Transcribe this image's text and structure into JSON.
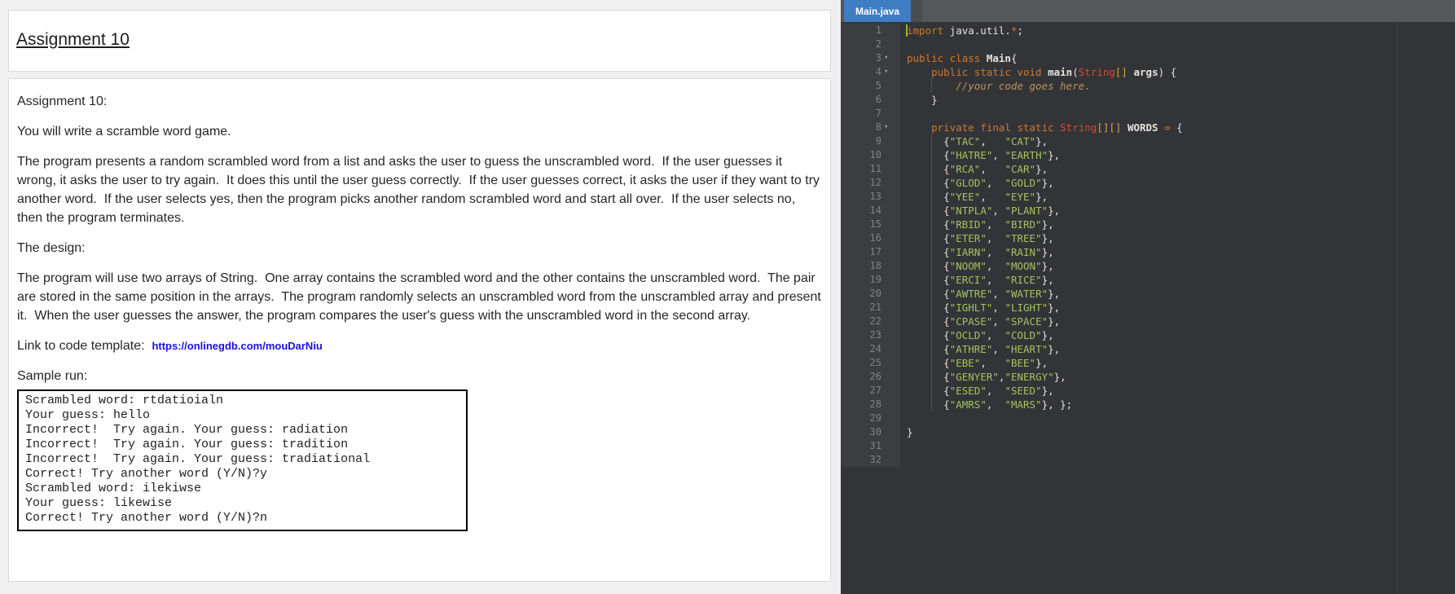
{
  "document": {
    "title": "Assignment 10",
    "heading_label": "Assignment 10:",
    "intro": "You will write a scramble word game.",
    "para1": "The program presents a random scrambled word from a list and asks the user to guess the unscrambled word.  If the user guesses it wrong, it asks the user to try again.  It does this until the user guess correctly.  If the user guesses correct, it asks the user if they want to try another word.  If the user selects yes, then the program picks another random scrambled word and start all over.  If the user selects no, then the program terminates.",
    "design_label": "The design:",
    "para2": "The program will use two arrays of String.  One array contains the scrambled word and the other contains the unscrambled word.  The pair are stored in the same position in the arrays.  The program randomly selects an unscrambled word from the unscrambled array and present it.  When the user guesses the answer, the program compares the user's guess with the unscrambled word in the second array.",
    "link_label": "Link to code template:",
    "link_url": "https://onlinegdb.com/mouDarNiu",
    "link_color": "#1a10e0",
    "sample_label": "Sample run:",
    "sample_lines": [
      "Scrambled word: rtdatioialn",
      "Your guess: hello",
      "Incorrect!  Try again. Your guess: radiation",
      "Incorrect!  Try again. Your guess: tradition",
      "Incorrect!  Try again. Your guess: tradiational",
      "Correct! Try another word (Y/N)?y",
      "Scrambled word: ilekiwse",
      "Your guess: likewise",
      "Correct! Try another word (Y/N)?n"
    ]
  },
  "editor": {
    "tab_title": "Main.java",
    "tab_color": "#3e7dc1",
    "background": "#333437",
    "gutter_background": "#3c3d40",
    "cursor_color": "#7fc41e",
    "fold_glyph": "▾",
    "palette": {
      "k": "#cc7833",
      "t": "#e6e1dc",
      "y": "#da4939",
      "b": "#d9a04a",
      "s": "#a5c261",
      "c": "#bc9458",
      "f": "#e6e1dc"
    },
    "lines": [
      {
        "n": 1,
        "cursor": true,
        "tokens": [
          [
            "k",
            "import"
          ],
          [
            "t",
            " java.util."
          ],
          [
            "k",
            "*"
          ],
          [
            "t",
            ";"
          ]
        ]
      },
      {
        "n": 2,
        "tokens": []
      },
      {
        "n": 3,
        "fold": true,
        "tokens": [
          [
            "k",
            "public class"
          ],
          [
            "f",
            " Main"
          ],
          [
            "t",
            "{"
          ]
        ]
      },
      {
        "n": 4,
        "fold": true,
        "tokens": [
          [
            "t",
            "    "
          ],
          [
            "k",
            "public static void"
          ],
          [
            "f",
            " main"
          ],
          [
            "t",
            "("
          ],
          [
            "y",
            "String"
          ],
          [
            "b",
            "[]"
          ],
          [
            "f",
            " args"
          ],
          [
            "t",
            ") {"
          ]
        ]
      },
      {
        "n": 5,
        "guide": true,
        "tokens": [
          [
            "c",
            "        //your code goes here."
          ]
        ]
      },
      {
        "n": 6,
        "tokens": [
          [
            "t",
            "    }"
          ]
        ]
      },
      {
        "n": 7,
        "tokens": []
      },
      {
        "n": 8,
        "fold": true,
        "tokens": [
          [
            "t",
            "    "
          ],
          [
            "k",
            "private final static"
          ],
          [
            "t",
            " "
          ],
          [
            "y",
            "String"
          ],
          [
            "b",
            "[][]"
          ],
          [
            "f",
            " WORDS"
          ],
          [
            "t",
            " "
          ],
          [
            "k",
            "="
          ],
          [
            "t",
            " {"
          ]
        ]
      },
      {
        "n": 9,
        "guide": true,
        "tokens": [
          [
            "t",
            "      {"
          ],
          [
            "s",
            "\"TAC\""
          ],
          [
            "t",
            ",   "
          ],
          [
            "s",
            "\"CAT\""
          ],
          [
            "t",
            "},"
          ]
        ]
      },
      {
        "n": 10,
        "guide": true,
        "tokens": [
          [
            "t",
            "      {"
          ],
          [
            "s",
            "\"HATRE\""
          ],
          [
            "t",
            ", "
          ],
          [
            "s",
            "\"EARTH\""
          ],
          [
            "t",
            "},"
          ]
        ]
      },
      {
        "n": 11,
        "guide": true,
        "tokens": [
          [
            "t",
            "      {"
          ],
          [
            "s",
            "\"RCA\""
          ],
          [
            "t",
            ",   "
          ],
          [
            "s",
            "\"CAR\""
          ],
          [
            "t",
            "},"
          ]
        ]
      },
      {
        "n": 12,
        "guide": true,
        "tokens": [
          [
            "t",
            "      {"
          ],
          [
            "s",
            "\"GLOD\""
          ],
          [
            "t",
            ",  "
          ],
          [
            "s",
            "\"GOLD\""
          ],
          [
            "t",
            "},"
          ]
        ]
      },
      {
        "n": 13,
        "guide": true,
        "tokens": [
          [
            "t",
            "      {"
          ],
          [
            "s",
            "\"YEE\""
          ],
          [
            "t",
            ",   "
          ],
          [
            "s",
            "\"EYE\""
          ],
          [
            "t",
            "},"
          ]
        ]
      },
      {
        "n": 14,
        "guide": true,
        "tokens": [
          [
            "t",
            "      {"
          ],
          [
            "s",
            "\"NTPLA\""
          ],
          [
            "t",
            ", "
          ],
          [
            "s",
            "\"PLANT\""
          ],
          [
            "t",
            "},"
          ]
        ]
      },
      {
        "n": 15,
        "guide": true,
        "tokens": [
          [
            "t",
            "      {"
          ],
          [
            "s",
            "\"RBID\""
          ],
          [
            "t",
            ",  "
          ],
          [
            "s",
            "\"BIRD\""
          ],
          [
            "t",
            "},"
          ]
        ]
      },
      {
        "n": 16,
        "guide": true,
        "tokens": [
          [
            "t",
            "      {"
          ],
          [
            "s",
            "\"ETER\""
          ],
          [
            "t",
            ",  "
          ],
          [
            "s",
            "\"TREE\""
          ],
          [
            "t",
            "},"
          ]
        ]
      },
      {
        "n": 17,
        "guide": true,
        "tokens": [
          [
            "t",
            "      {"
          ],
          [
            "s",
            "\"IARN\""
          ],
          [
            "t",
            ",  "
          ],
          [
            "s",
            "\"RAIN\""
          ],
          [
            "t",
            "},"
          ]
        ]
      },
      {
        "n": 18,
        "guide": true,
        "tokens": [
          [
            "t",
            "      {"
          ],
          [
            "s",
            "\"NOOM\""
          ],
          [
            "t",
            ",  "
          ],
          [
            "s",
            "\"MOON\""
          ],
          [
            "t",
            "},"
          ]
        ]
      },
      {
        "n": 19,
        "guide": true,
        "tokens": [
          [
            "t",
            "      {"
          ],
          [
            "s",
            "\"ERCI\""
          ],
          [
            "t",
            ",  "
          ],
          [
            "s",
            "\"RICE\""
          ],
          [
            "t",
            "},"
          ]
        ]
      },
      {
        "n": 20,
        "guide": true,
        "tokens": [
          [
            "t",
            "      {"
          ],
          [
            "s",
            "\"AWTRE\""
          ],
          [
            "t",
            ", "
          ],
          [
            "s",
            "\"WATER\""
          ],
          [
            "t",
            "},"
          ]
        ]
      },
      {
        "n": 21,
        "guide": true,
        "tokens": [
          [
            "t",
            "      {"
          ],
          [
            "s",
            "\"IGHLT\""
          ],
          [
            "t",
            ", "
          ],
          [
            "s",
            "\"LIGHT\""
          ],
          [
            "t",
            "},"
          ]
        ]
      },
      {
        "n": 22,
        "guide": true,
        "tokens": [
          [
            "t",
            "      {"
          ],
          [
            "s",
            "\"CPASE\""
          ],
          [
            "t",
            ", "
          ],
          [
            "s",
            "\"SPACE\""
          ],
          [
            "t",
            "},"
          ]
        ]
      },
      {
        "n": 23,
        "guide": true,
        "tokens": [
          [
            "t",
            "      {"
          ],
          [
            "s",
            "\"OCLD\""
          ],
          [
            "t",
            ",  "
          ],
          [
            "s",
            "\"COLD\""
          ],
          [
            "t",
            "},"
          ]
        ]
      },
      {
        "n": 24,
        "guide": true,
        "tokens": [
          [
            "t",
            "      {"
          ],
          [
            "s",
            "\"ATHRE\""
          ],
          [
            "t",
            ", "
          ],
          [
            "s",
            "\"HEART\""
          ],
          [
            "t",
            "},"
          ]
        ]
      },
      {
        "n": 25,
        "guide": true,
        "tokens": [
          [
            "t",
            "      {"
          ],
          [
            "s",
            "\"EBE\""
          ],
          [
            "t",
            ",   "
          ],
          [
            "s",
            "\"BEE\""
          ],
          [
            "t",
            "},"
          ]
        ]
      },
      {
        "n": 26,
        "guide": true,
        "tokens": [
          [
            "t",
            "      {"
          ],
          [
            "s",
            "\"GENYER\""
          ],
          [
            "t",
            ","
          ],
          [
            "s",
            "\"ENERGY\""
          ],
          [
            "t",
            "},"
          ]
        ]
      },
      {
        "n": 27,
        "guide": true,
        "tokens": [
          [
            "t",
            "      {"
          ],
          [
            "s",
            "\"ESED\""
          ],
          [
            "t",
            ",  "
          ],
          [
            "s",
            "\"SEED\""
          ],
          [
            "t",
            "},"
          ]
        ]
      },
      {
        "n": 28,
        "guide": true,
        "tokens": [
          [
            "t",
            "      {"
          ],
          [
            "s",
            "\"AMRS\""
          ],
          [
            "t",
            ",  "
          ],
          [
            "s",
            "\"MARS\""
          ],
          [
            "t",
            "}, };"
          ]
        ]
      },
      {
        "n": 29,
        "tokens": []
      },
      {
        "n": 30,
        "tokens": [
          [
            "t",
            "}"
          ]
        ]
      },
      {
        "n": 31,
        "tokens": []
      },
      {
        "n": 32,
        "tokens": []
      }
    ]
  }
}
